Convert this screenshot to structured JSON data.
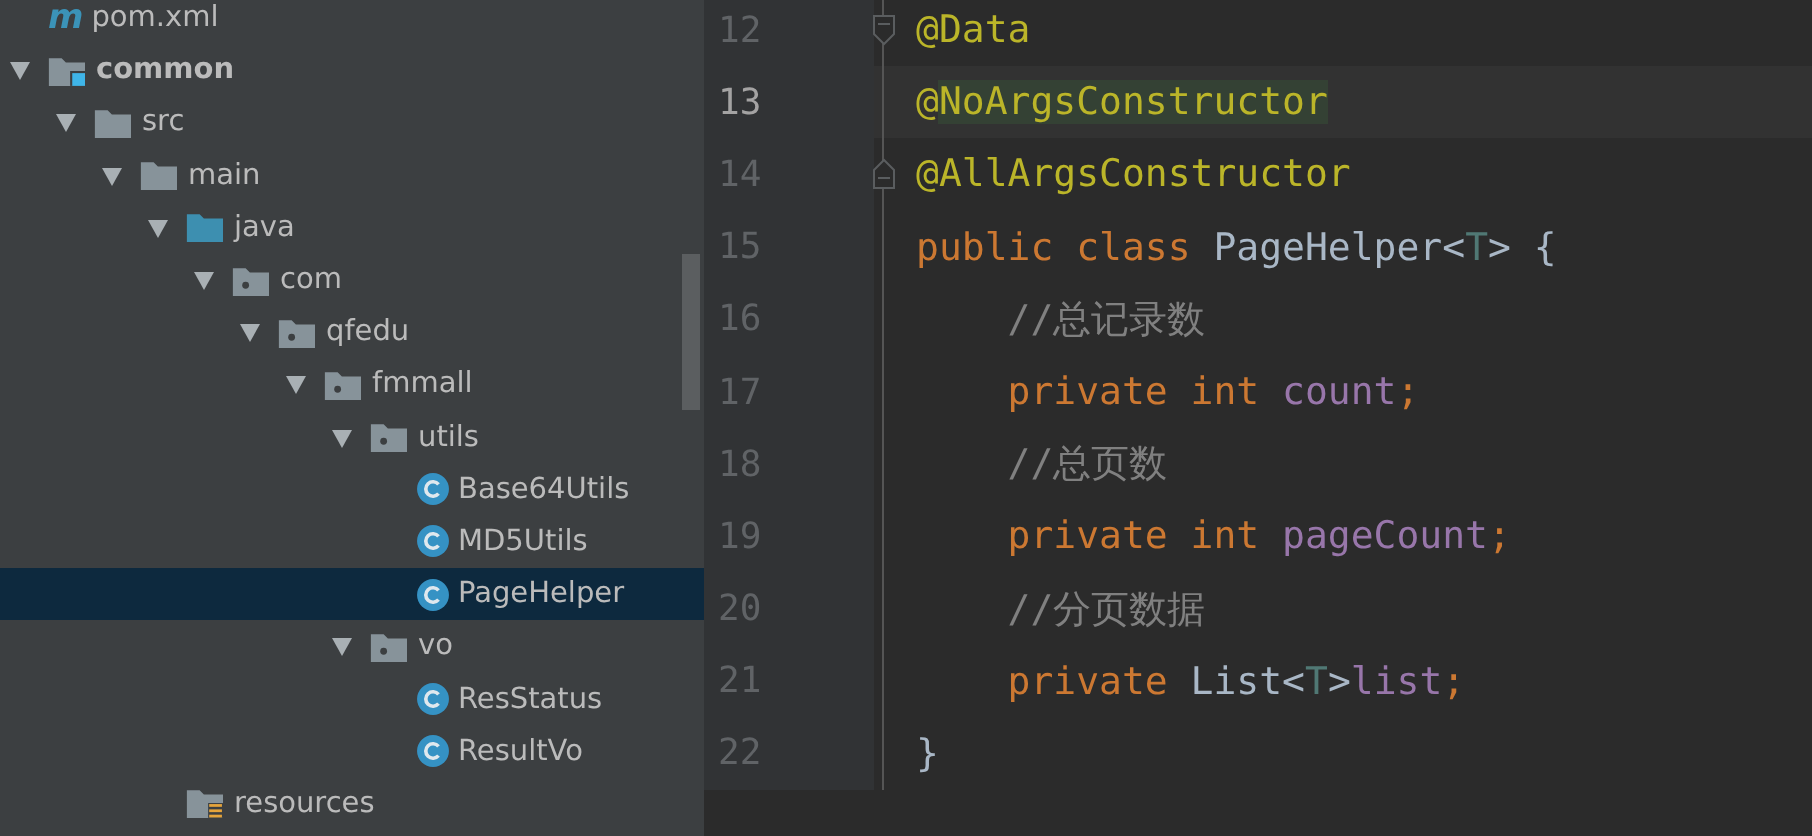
{
  "project_tree": {
    "items": [
      {
        "label": "pom.xml",
        "kind": "maven",
        "icon_text": "m",
        "selected": false
      },
      {
        "label": "common",
        "kind": "module",
        "expanded": true,
        "selected": false,
        "children": [
          {
            "label": "src",
            "kind": "folder",
            "expanded": true,
            "selected": false,
            "children": [
              {
                "label": "main",
                "kind": "folder",
                "expanded": true,
                "selected": false,
                "children": [
                  {
                    "label": "java",
                    "kind": "source-root",
                    "expanded": true,
                    "selected": false,
                    "children": [
                      {
                        "label": "com",
                        "kind": "package",
                        "expanded": true,
                        "selected": false,
                        "children": [
                          {
                            "label": "qfedu",
                            "kind": "package",
                            "expanded": true,
                            "selected": false,
                            "children": [
                              {
                                "label": "fmmall",
                                "kind": "package",
                                "expanded": true,
                                "selected": false,
                                "children": [
                                  {
                                    "label": "utils",
                                    "kind": "package",
                                    "expanded": true,
                                    "selected": false,
                                    "children": [
                                      {
                                        "label": "Base64Utils",
                                        "kind": "class",
                                        "selected": false
                                      },
                                      {
                                        "label": "MD5Utils",
                                        "kind": "class",
                                        "selected": false
                                      },
                                      {
                                        "label": "PageHelper",
                                        "kind": "class",
                                        "selected": true
                                      }
                                    ]
                                  },
                                  {
                                    "label": "vo",
                                    "kind": "package",
                                    "expanded": true,
                                    "selected": false,
                                    "children": [
                                      {
                                        "label": "ResStatus",
                                        "kind": "class",
                                        "selected": false
                                      },
                                      {
                                        "label": "ResultVo",
                                        "kind": "class",
                                        "selected": false
                                      }
                                    ]
                                  }
                                ]
                              }
                            ]
                          }
                        ]
                      }
                    ]
                  },
                  {
                    "label": "resources",
                    "kind": "resources",
                    "selected": false
                  }
                ]
              }
            ]
          }
        ]
      }
    ]
  },
  "editor": {
    "lines": [
      {
        "number": "12",
        "current": false,
        "fold_start": true,
        "tokens": [
          {
            "text": "@Data",
            "kind": "annotation"
          }
        ]
      },
      {
        "number": "13",
        "current": true,
        "tokens": [
          {
            "text": "@",
            "kind": "annotation"
          },
          {
            "text": "NoArgsConstructor",
            "kind": "annotation",
            "highlighted": true
          }
        ]
      },
      {
        "number": "14",
        "current": false,
        "fold_end": true,
        "tokens": [
          {
            "text": "@AllArgsConstructor",
            "kind": "annotation"
          }
        ]
      },
      {
        "number": "15",
        "current": false,
        "tokens": [
          {
            "text": "public class ",
            "kind": "keyword"
          },
          {
            "text": "PageHelper<",
            "kind": "plain"
          },
          {
            "text": "T",
            "kind": "typeparam"
          },
          {
            "text": "> {",
            "kind": "plain"
          }
        ]
      },
      {
        "number": "16",
        "current": false,
        "tokens": [
          {
            "text": "    //总记录数",
            "kind": "comment"
          }
        ]
      },
      {
        "number": "17",
        "current": false,
        "tokens": [
          {
            "text": "    private int ",
            "kind": "keyword"
          },
          {
            "text": "count",
            "kind": "field"
          },
          {
            "text": ";",
            "kind": "keyword"
          }
        ]
      },
      {
        "number": "18",
        "current": false,
        "tokens": [
          {
            "text": "    //总页数",
            "kind": "comment"
          }
        ]
      },
      {
        "number": "19",
        "current": false,
        "tokens": [
          {
            "text": "    private int ",
            "kind": "keyword"
          },
          {
            "text": "pageCount",
            "kind": "field"
          },
          {
            "text": ";",
            "kind": "keyword"
          }
        ]
      },
      {
        "number": "20",
        "current": false,
        "tokens": [
          {
            "text": "    //分页数据",
            "kind": "comment"
          }
        ]
      },
      {
        "number": "21",
        "current": false,
        "tokens": [
          {
            "text": "    private ",
            "kind": "keyword"
          },
          {
            "text": "List<",
            "kind": "plain"
          },
          {
            "text": "T",
            "kind": "typeparam"
          },
          {
            "text": ">",
            "kind": "plain"
          },
          {
            "text": "list",
            "kind": "field"
          },
          {
            "text": ";",
            "kind": "keyword"
          }
        ]
      },
      {
        "number": "22",
        "current": false,
        "tokens": [
          {
            "text": "}",
            "kind": "plain"
          }
        ]
      }
    ]
  }
}
